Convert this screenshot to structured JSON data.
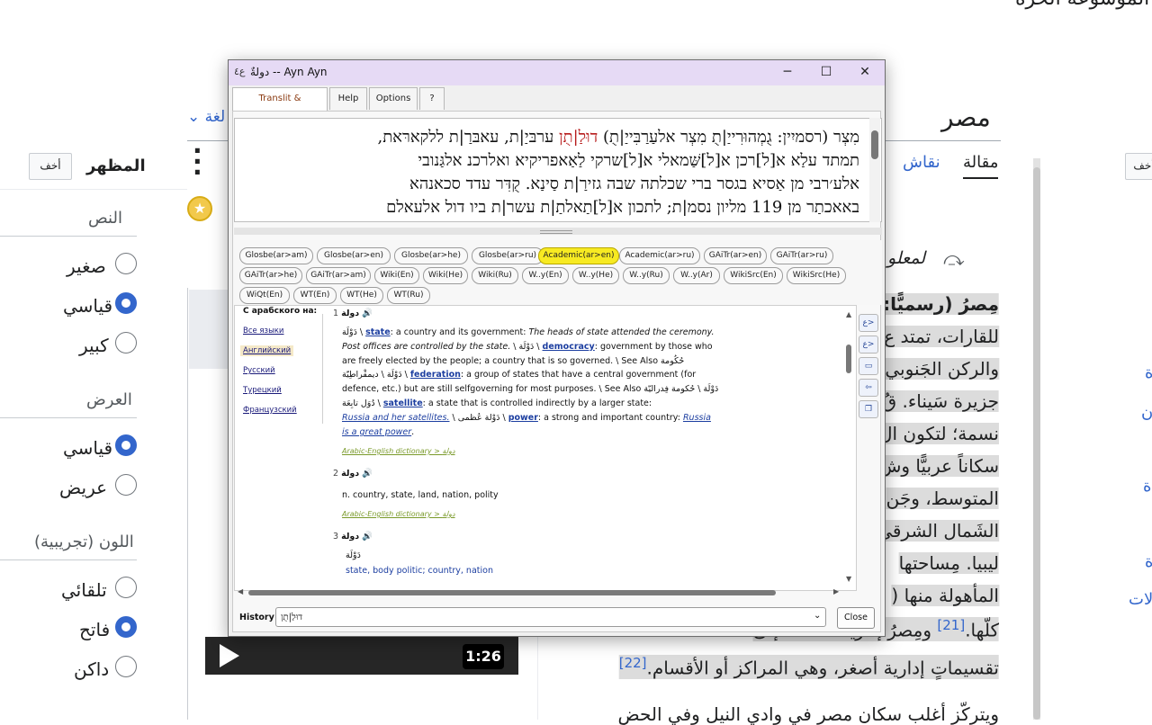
{
  "wiki": {
    "brand": "الموسوعة الحرة",
    "title": "مصر",
    "lang_button": "لغة",
    "tab_article": "مقالة",
    "tab_talk": "نقاش",
    "hatnote": "لمعلو",
    "appearance": {
      "title": "المظهر",
      "hide_label": "أخف",
      "hide_label_right": "أخف",
      "text_heading": "النص",
      "text_options": [
        "صغير",
        "قياسي",
        "كبير"
      ],
      "width_heading": "العرض",
      "width_options": [
        "قياسي",
        "عريض"
      ],
      "color_heading": "اللون (تجريبية)",
      "color_options": [
        "تلقائي",
        "فاتح",
        "داكن"
      ]
    },
    "video_duration": "1:26",
    "article_lines": [
      "مِصرُ (رسميًّا: جُ",
      "للقارات، تمتد ع",
      "والركن الجَنوبي",
      "جزيرة سَيناء. قُ",
      "نسمة؛ لتكون ال",
      "سكاناً عربيًّا وش",
      "المتوسط، وجَن",
      "الشَمال الشرقي",
      "ليبيا. مِساحتها",
      "المأهولة منها (",
      "كلّها.",
      "تقسيماتٍ إدارية أصغر، وهي المراكز أو الأقسام."
    ],
    "line11_tail": "ومِصرُ إدارياً مُقسّمة إلى",
    "ref_21": "[21]",
    "ref_22": "[22]",
    "last_line": "ويتركّز أغلب سكان مصر في وادي النيل وفي الحض",
    "side_links": [
      "ة",
      "ة",
      "ن",
      "ة",
      "لات"
    ]
  },
  "dialog": {
    "title": "دولةٌ -- Ayn Ayn",
    "app_icon": "ع٤",
    "window_buttons": [
      "─",
      "☐",
      "✕"
    ],
    "tabs": [
      "Translit & Translation",
      "Help",
      "Options",
      "?"
    ],
    "hebrew_lines": [
      "מִצְר (רסמיִין: גֻמְהוּרִייַ|תֻ מִצְר אלעַרַבִּייַ|תֻ) דוּלַ|תֻן ערבּיַ|ת, עאבּרַ|ת ללקארּאת,",
      "תמתד עלַא א[ל]רכן א[ל]שַּׁמאלי א[ל]שרקי לַאַאפריקיא ואלרכנ אלגַּנובי",
      "אלע׳רבי מן אַסיא בגסר ברי שכלתה שבה גזירַ|ת סַינַא. קֻדִּר עדד סכאנהא",
      "באאכתַר מן 119 מליון נסמ|ת; לתכון א[ל]תַאלתַ|ת עשר|ת ביו דול אלעאלם"
    ],
    "hebrew_red": "דוּלַ|תֻן",
    "chips": [
      "Glosbe(ar>am)",
      "Glosbe(ar>en)",
      "Glosbe(ar>he)",
      "Glosbe(ar>ru)",
      "Academic(ar>en)",
      "Academic(ar>ru)",
      "GAiTr(ar>en)",
      "GAiTr(ar>ru)",
      "GAiTr(ar>he)",
      "GAiTr(ar>am)",
      "Wiki(En)",
      "Wiki(He)",
      "Wiki(Ru)",
      "W..y(En)",
      "W..y(He)",
      "W..y(Ru)",
      "W..y(Ar)",
      "WikiSrc(En)",
      "WikiSrc(He)",
      "WiQt(En)",
      "WT(En)",
      "WT(He)",
      "WT(Ru)"
    ],
    "active_chip": "Academic(ar>en)",
    "lang_heading": "С арабского на:",
    "lang_items": [
      "Все языки",
      "Английский",
      "Русский",
      "Турецкий",
      "Французский"
    ],
    "active_lang": "Английский",
    "entries": {
      "e1_num": "1",
      "e1_head": "دولة",
      "e1_l1_a": "دَوْلَة \\",
      "e1_l1_link": "state",
      "e1_l1_b": ": a country and its government: ",
      "e1_l1_ital": "The heads of state attended the ceremony.",
      "e1_l2_ital": "Post offices are controlled by the state.",
      "e1_l2_a": " \\ دَوْلَة \\ ",
      "e1_l2_link": "democracy",
      "e1_l2_b": ": government by those who",
      "e1_l3": "are freely elected by the people; a country that is so governed. \\ See Also حُكُومة",
      "e1_l4_a": "دَوْلَة \\ ديمقْراطِيّة \\ ",
      "e1_l4_link": "federation",
      "e1_l4_b": ": a group of states that have a central government (for",
      "e1_l5": "defence, etc.) but are still selfgoverning for most purposes. \\ See Also دَوْلَة \\ حُكومة فِدراليّة",
      "e1_l6_a": "دُوَل تابِعَة \\ ",
      "e1_l6_link": "satellite",
      "e1_l6_b": ": a state that is controlled indirectly by a larger state:",
      "e1_l7_it": "Russia and her satellites.",
      "e1_l7_a": " \\ دَوْلة عُظمى \\ ",
      "e1_l7_link": "power",
      "e1_l7_b": ": a strong and important country: ",
      "e1_l7_it2": "Russia",
      "e1_l8_it": "is a great power",
      "e1_l8_end": ".",
      "e1_src": "Arabic-English dictionary > دولة",
      "e2_num": "2",
      "e2_head": "دولة",
      "e2_body": "n. country, state, land, nation, polity",
      "e2_src": "Arabic-English dictionary > دولة",
      "e3_num": "3",
      "e3_head": "دولة",
      "e3_word": "دَوْلَة",
      "e3_body": "state, body politic; country, nation"
    },
    "history_label": "History",
    "history_value": "דוּלַ|תֻן",
    "close_label": "Close",
    "tool_icons": [
      "ع>",
      "ع>",
      "▭",
      "⇦",
      "❐"
    ]
  }
}
